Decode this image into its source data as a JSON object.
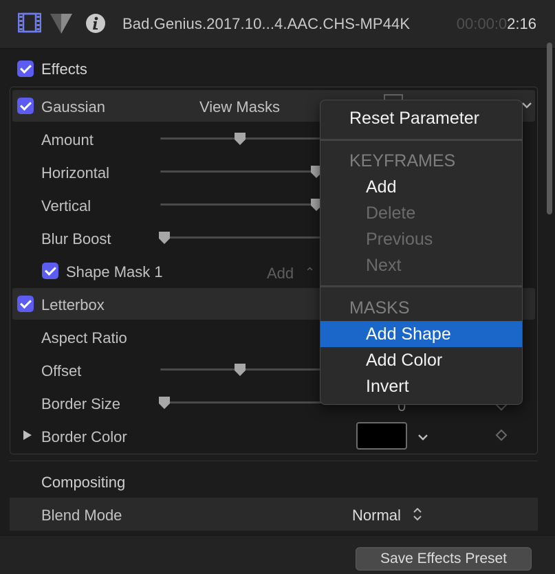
{
  "header": {
    "clip_title": "Bad.Genius.2017.10...4.AAC.CHS-MP44K",
    "timecode_dim": "00:00:0",
    "timecode_lit": "2:16",
    "icons": [
      "film-icon",
      "inspector-shield-icon",
      "info-icon"
    ]
  },
  "effects": {
    "label": "Effects",
    "gaussian": {
      "label": "Gaussian",
      "view_masks": "View Masks",
      "params": {
        "amount": "Amount",
        "horizontal": "Horizontal",
        "vertical": "Vertical",
        "blur_boost": "Blur Boost"
      },
      "shape_mask": {
        "label": "Shape Mask 1",
        "add": "Add"
      }
    },
    "letterbox": {
      "label": "Letterbox",
      "params": {
        "aspect_ratio": "Aspect Ratio",
        "offset": "Offset",
        "border_size": "Border Size",
        "border_size_value": "0",
        "border_color": "Border Color"
      }
    }
  },
  "compositing": {
    "label": "Compositing",
    "blend_mode_label": "Blend Mode",
    "blend_mode_value": "Normal"
  },
  "footer": {
    "save_preset": "Save Effects Preset"
  },
  "context_menu": {
    "reset": "Reset Parameter",
    "keyframes_header": "KEYFRAMES",
    "add": "Add",
    "delete": "Delete",
    "previous": "Previous",
    "next": "Next",
    "masks_header": "MASKS",
    "add_shape": "Add Shape",
    "add_color": "Add Color",
    "invert": "Invert"
  },
  "colors": {
    "checkbox": "#5d5cf0",
    "menu_highlight": "#1a66c9",
    "border_color_well": "#000000"
  }
}
